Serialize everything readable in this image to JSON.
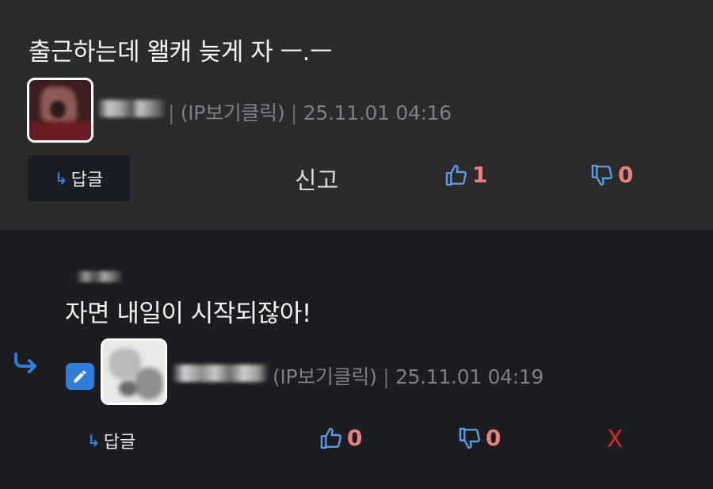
{
  "comment": {
    "text": "출근하는데 왤캐 늦게 자 ㅡ.ㅡ",
    "meta_separator": "|",
    "ip_label": "(IP보기클릭)",
    "datetime": "25.11.01 04:16",
    "actions": {
      "reply_arrow": "↳",
      "reply_label": "답글",
      "report_label": "신고",
      "upvote_count": "1",
      "downvote_count": "0"
    }
  },
  "reply": {
    "text": "자면 내일이 시작되잖아!",
    "meta_separator": "|",
    "ip_label": "(IP보기클릭)",
    "datetime": "25.11.01 04:19",
    "actions": {
      "reply_arrow": "↳",
      "reply_label": "답글",
      "upvote_count": "0",
      "downvote_count": "0",
      "delete_label": "X"
    }
  },
  "colors": {
    "comment_bg": "#2b2b2d",
    "reply_bg": "#1c1d21",
    "accent_blue": "#2f7fd9",
    "vote_count": "#e9827e",
    "delete_red": "#d12b2b",
    "meta_gray": "#7e7f84"
  },
  "icons": {
    "thumbs_up": "thumbs-up-icon",
    "thumbs_down": "thumbs-down-icon",
    "reply_arrow": "reply-arrow-icon",
    "edit": "pencil-icon"
  }
}
